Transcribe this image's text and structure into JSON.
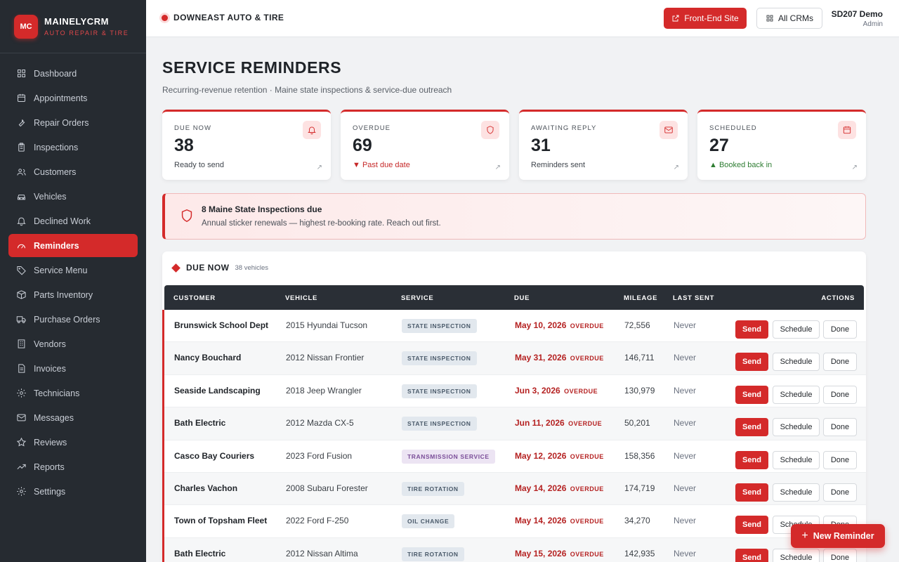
{
  "brand": {
    "logo": "MC",
    "name": "MAINELYCRM",
    "sub": "AUTO REPAIR & TIRE"
  },
  "nav": [
    {
      "label": "Dashboard",
      "icon": "grid-icon"
    },
    {
      "label": "Appointments",
      "icon": "calendar-icon"
    },
    {
      "label": "Repair Orders",
      "icon": "wrench-icon"
    },
    {
      "label": "Inspections",
      "icon": "clipboard-icon"
    },
    {
      "label": "Customers",
      "icon": "users-icon"
    },
    {
      "label": "Vehicles",
      "icon": "car-icon"
    },
    {
      "label": "Declined Work",
      "icon": "bell-icon"
    },
    {
      "label": "Reminders",
      "icon": "gauge-icon",
      "active": true
    },
    {
      "label": "Service Menu",
      "icon": "tag-icon"
    },
    {
      "label": "Parts Inventory",
      "icon": "box-icon"
    },
    {
      "label": "Purchase Orders",
      "icon": "truck-icon"
    },
    {
      "label": "Vendors",
      "icon": "building-icon"
    },
    {
      "label": "Invoices",
      "icon": "document-icon"
    },
    {
      "label": "Technicians",
      "icon": "gear-icon"
    },
    {
      "label": "Messages",
      "icon": "mail-icon"
    },
    {
      "label": "Reviews",
      "icon": "star-icon"
    },
    {
      "label": "Reports",
      "icon": "trend-icon"
    },
    {
      "label": "Settings",
      "icon": "settings-icon"
    }
  ],
  "topbar": {
    "shop": "DOWNEAST AUTO & TIRE",
    "front_end": "Front-End Site",
    "all_crms": "All CRMs",
    "user_name": "SD207 Demo",
    "user_role": "Admin"
  },
  "page": {
    "title": "SERVICE REMINDERS",
    "subtitle": "Recurring-revenue retention · Maine state inspections & service-due outreach"
  },
  "stats": [
    {
      "label": "DUE NOW",
      "value": "38",
      "note": "Ready to send",
      "icon": "bell-icon"
    },
    {
      "label": "OVERDUE",
      "value": "69",
      "note": "▼ Past due date",
      "icon": "shield-icon"
    },
    {
      "label": "AWAITING REPLY",
      "value": "31",
      "note": "Reminders sent",
      "icon": "mail-icon"
    },
    {
      "label": "SCHEDULED",
      "value": "27",
      "note": "▲ Booked back in",
      "icon": "calendar-icon"
    }
  ],
  "alert": {
    "title": "8 Maine State Inspections due",
    "subtitle": "Annual sticker renewals — highest re-booking rate. Reach out first."
  },
  "table": {
    "title": "DUE NOW",
    "count": "38 vehicles",
    "headers": [
      "CUSTOMER",
      "VEHICLE",
      "SERVICE",
      "DUE",
      "MILEAGE",
      "LAST SENT",
      "ACTIONS"
    ],
    "overdue_label": "OVERDUE",
    "send_label": "Send",
    "schedule_label": "Schedule",
    "done_label": "Done",
    "rows": [
      {
        "customer": "Brunswick School Dept",
        "vehicle": "2015 Hyundai Tucson",
        "service": "STATE INSPECTION",
        "due": "May 10, 2026",
        "mileage": "72,556",
        "last_sent": "Never"
      },
      {
        "customer": "Nancy Bouchard",
        "vehicle": "2012 Nissan Frontier",
        "service": "STATE INSPECTION",
        "due": "May 31, 2026",
        "mileage": "146,711",
        "last_sent": "Never"
      },
      {
        "customer": "Seaside Landscaping",
        "vehicle": "2018 Jeep Wrangler",
        "service": "STATE INSPECTION",
        "due": "Jun 3, 2026",
        "mileage": "130,979",
        "last_sent": "Never"
      },
      {
        "customer": "Bath Electric",
        "vehicle": "2012 Mazda CX-5",
        "service": "STATE INSPECTION",
        "due": "Jun 11, 2026",
        "mileage": "50,201",
        "last_sent": "Never"
      },
      {
        "customer": "Casco Bay Couriers",
        "vehicle": "2023 Ford Fusion",
        "service": "TRANSMISSION SERVICE",
        "due": "May 12, 2026",
        "mileage": "158,356",
        "last_sent": "Never",
        "purple": true
      },
      {
        "customer": "Charles Vachon",
        "vehicle": "2008 Subaru Forester",
        "service": "TIRE ROTATION",
        "due": "May 14, 2026",
        "mileage": "174,719",
        "last_sent": "Never"
      },
      {
        "customer": "Town of Topsham Fleet",
        "vehicle": "2022 Ford F-250",
        "service": "OIL CHANGE",
        "due": "May 14, 2026",
        "mileage": "34,270",
        "last_sent": "Never"
      },
      {
        "customer": "Bath Electric",
        "vehicle": "2012 Nissan Altima",
        "service": "TIRE ROTATION",
        "due": "May 15, 2026",
        "mileage": "142,935",
        "last_sent": "Never"
      }
    ]
  },
  "fab": {
    "label": "New Reminder"
  },
  "colors": {
    "accent": "#d42a2a",
    "sidebar": "#262b31"
  }
}
